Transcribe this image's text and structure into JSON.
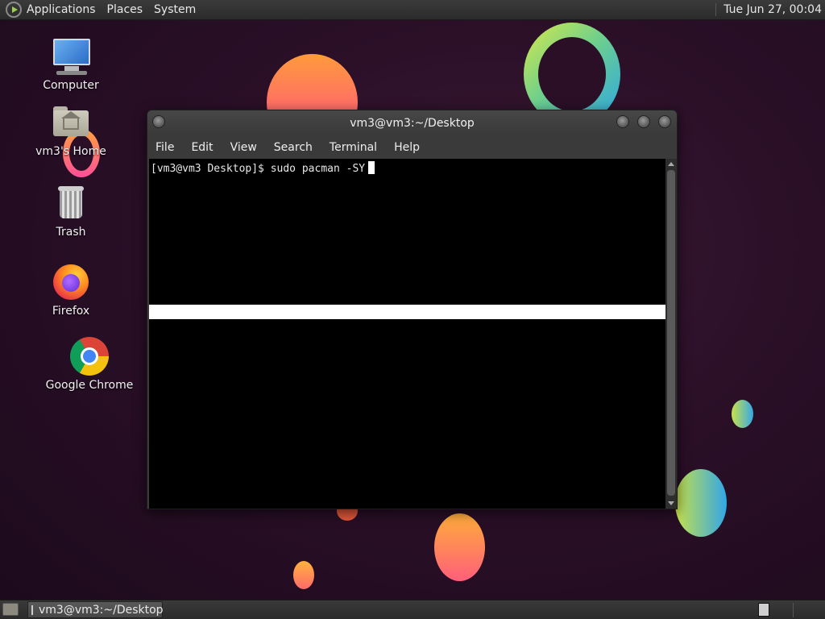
{
  "top_panel": {
    "menus": [
      "Applications",
      "Places",
      "System"
    ],
    "clock": "Tue Jun 27, 00:04"
  },
  "desktop_icons": [
    {
      "label": "Computer",
      "icon": "computer-icon"
    },
    {
      "label": "vm3's Home",
      "icon": "home-folder-icon"
    },
    {
      "label": "Trash",
      "icon": "trash-icon"
    },
    {
      "label": "Firefox",
      "icon": "firefox-icon"
    },
    {
      "label": "Google Chrome",
      "icon": "chrome-icon"
    }
  ],
  "terminal": {
    "title": "vm3@vm3:~/Desktop",
    "menu": [
      "File",
      "Edit",
      "View",
      "Search",
      "Terminal",
      "Help"
    ],
    "prompt": "[vm3@vm3 Desktop]$ sudo pacman -SY"
  },
  "bottom_panel": {
    "task_label": "vm3@vm3:~/Desktop"
  }
}
